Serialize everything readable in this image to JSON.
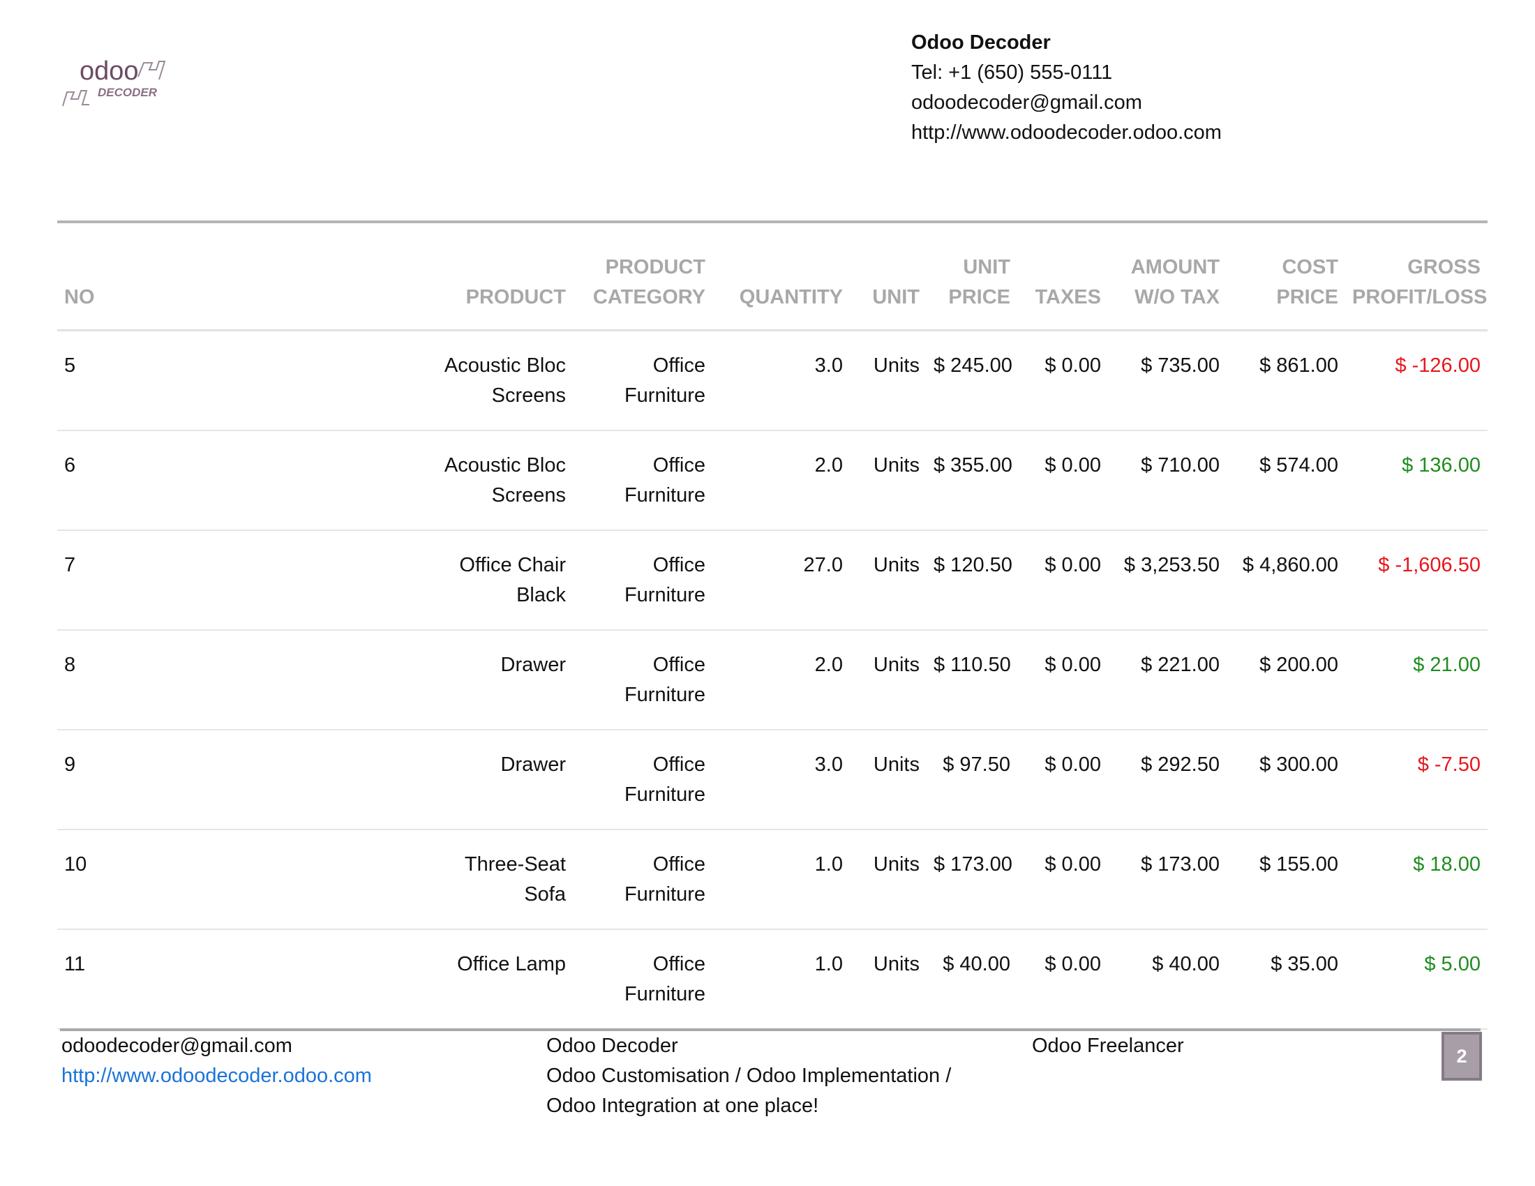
{
  "logo": {
    "text": "odoo",
    "subtext": "DECODER"
  },
  "company": {
    "name": "Odoo Decoder",
    "tel": "Tel: +1 (650) 555-0111",
    "email": "odoodecoder@gmail.com",
    "website": "http://www.odoodecoder.odoo.com"
  },
  "table": {
    "headers": {
      "no": "NO",
      "product": "PRODUCT",
      "category": [
        "PRODUCT",
        "CATEGORY"
      ],
      "quantity": "QUANTITY",
      "unit": "UNIT",
      "unit_price": [
        "UNIT",
        "PRICE"
      ],
      "taxes": "TAXES",
      "amount": [
        "AMOUNT",
        "W/O TAX"
      ],
      "cost": [
        "COST",
        "PRICE"
      ],
      "gross": [
        "GROSS",
        "PROFIT/LOSS"
      ]
    },
    "rows": [
      {
        "no": "5",
        "product": [
          "Acoustic Bloc",
          "Screens"
        ],
        "category": [
          "Office",
          "Furniture"
        ],
        "quantity": "3.0",
        "unit": "Units",
        "unit_price": "$ 245.00",
        "taxes": "$ 0.00",
        "amount": "$ 735.00",
        "cost": "$ 861.00",
        "gross": "$ -126.00",
        "gross_sign": "neg"
      },
      {
        "no": "6",
        "product": [
          "Acoustic Bloc",
          "Screens"
        ],
        "category": [
          "Office",
          "Furniture"
        ],
        "quantity": "2.0",
        "unit": "Units",
        "unit_price": "$ 355.00",
        "taxes": "$ 0.00",
        "amount": "$ 710.00",
        "cost": "$ 574.00",
        "gross": "$ 136.00",
        "gross_sign": "pos"
      },
      {
        "no": "7",
        "product": [
          "Office Chair",
          "Black"
        ],
        "category": [
          "Office",
          "Furniture"
        ],
        "quantity": "27.0",
        "unit": "Units",
        "unit_price": "$ 120.50",
        "taxes": "$ 0.00",
        "amount": "$ 3,253.50",
        "cost": "$ 4,860.00",
        "gross": "$ -1,606.50",
        "gross_sign": "neg"
      },
      {
        "no": "8",
        "product": [
          "Drawer"
        ],
        "category": [
          "Office",
          "Furniture"
        ],
        "quantity": "2.0",
        "unit": "Units",
        "unit_price": "$ 110.50",
        "taxes": "$ 0.00",
        "amount": "$ 221.00",
        "cost": "$ 200.00",
        "gross": "$ 21.00",
        "gross_sign": "pos"
      },
      {
        "no": "9",
        "product": [
          "Drawer"
        ],
        "category": [
          "Office",
          "Furniture"
        ],
        "quantity": "3.0",
        "unit": "Units",
        "unit_price": "$ 97.50",
        "taxes": "$ 0.00",
        "amount": "$ 292.50",
        "cost": "$ 300.00",
        "gross": "$ -7.50",
        "gross_sign": "neg"
      },
      {
        "no": "10",
        "product": [
          "Three-Seat",
          "Sofa"
        ],
        "category": [
          "Office",
          "Furniture"
        ],
        "quantity": "1.0",
        "unit": "Units",
        "unit_price": "$ 173.00",
        "taxes": "$ 0.00",
        "amount": "$ 173.00",
        "cost": "$ 155.00",
        "gross": "$ 18.00",
        "gross_sign": "pos"
      },
      {
        "no": "11",
        "product": [
          "Office Lamp"
        ],
        "category": [
          "Office",
          "Furniture"
        ],
        "quantity": "1.0",
        "unit": "Units",
        "unit_price": "$ 40.00",
        "taxes": "$ 0.00",
        "amount": "$ 40.00",
        "cost": "$ 35.00",
        "gross": "$ 5.00",
        "gross_sign": "pos"
      }
    ]
  },
  "footer": {
    "email": "odoodecoder@gmail.com",
    "website": "http://www.odoodecoder.odoo.com",
    "company": "Odoo Decoder",
    "tagline": [
      "Odoo Customisation / Odoo Implementation /",
      "Odoo Integration at one place!"
    ],
    "role": "Odoo Freelancer",
    "page": "2"
  },
  "colors": {
    "negative": "#e8161c",
    "positive": "#1f8d1f",
    "link": "#1a73d8",
    "header_text": "#a8a8a8",
    "logo": "#6b4c63"
  }
}
